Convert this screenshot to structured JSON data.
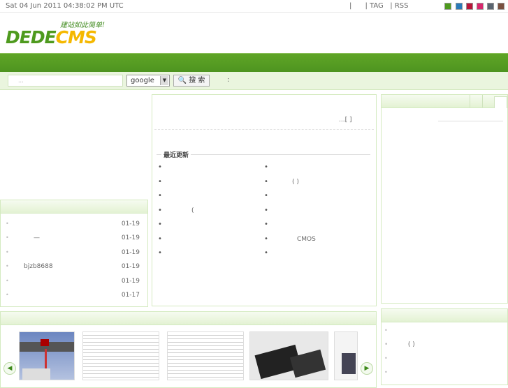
{
  "topbar": {
    "date": "Sat 04 Jun 2011 04:38:02 PM UTC",
    "links": [
      "|",
      "| TAG",
      "| RSS"
    ],
    "swatches": [
      "#4e9a1e",
      "#2a7ab8",
      "#b8163a",
      "#d8286e",
      "#5a6470",
      "#7a5040"
    ]
  },
  "logo": {
    "slogan": "建站如此简单!",
    "text_dede": "DEDE",
    "text_cms": "CMS"
  },
  "search": {
    "placeholder": "...",
    "engine": "google",
    "button": "搜 索",
    "extra": ":"
  },
  "center": {
    "more": "...[ ]",
    "section_title": "最近更新",
    "left_items": [
      "",
      "",
      "",
      "(",
      "",
      "",
      ""
    ],
    "right_items": [
      "",
      "( )",
      "",
      "",
      "",
      "CMOS",
      ""
    ]
  },
  "left_list": {
    "items": [
      {
        "title": "",
        "date": "01-19"
      },
      {
        "title": "—",
        "date": "01-19"
      },
      {
        "title": "",
        "date": "01-19"
      },
      {
        "title": "bjzb8688",
        "date": "01-19"
      },
      {
        "title": "",
        "date": "01-19"
      },
      {
        "title": "",
        "date": "01-17"
      }
    ]
  },
  "right_bottom": {
    "items": [
      "",
      "( )",
      "",
      ""
    ]
  }
}
